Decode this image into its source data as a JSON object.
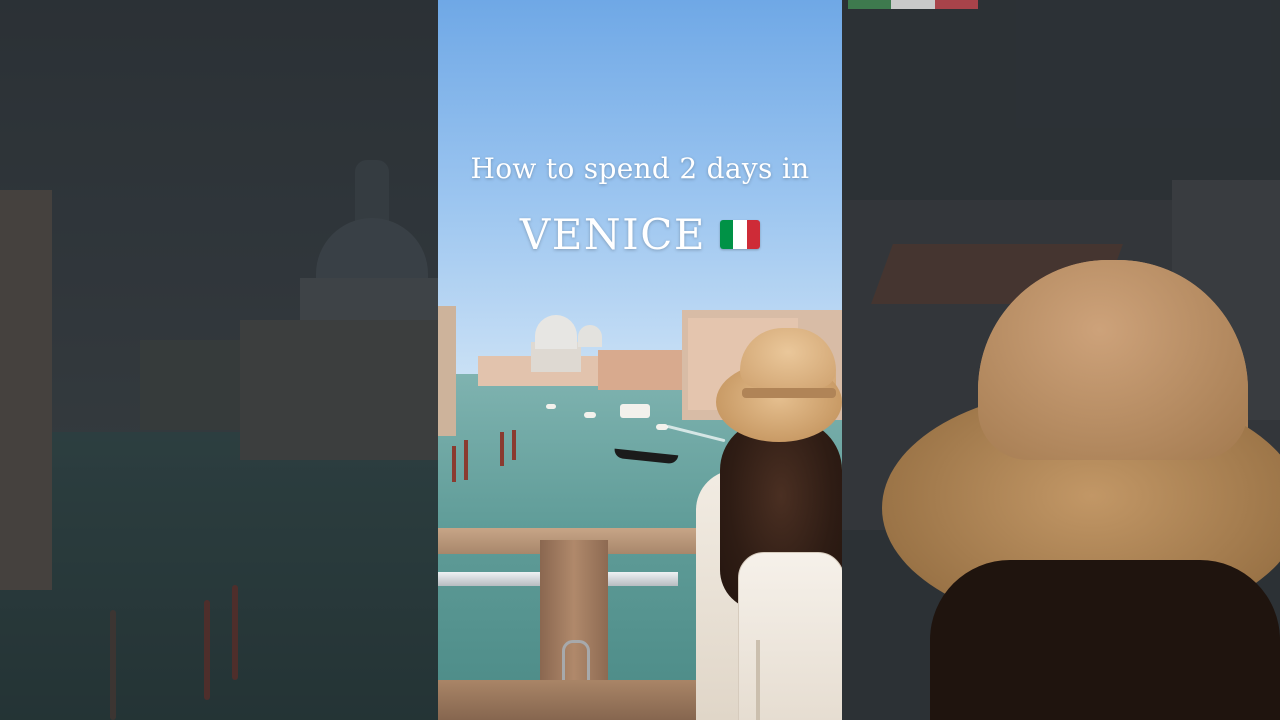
{
  "overlay": {
    "line1": "How to spend 2 days in",
    "line2": "VENICE"
  },
  "flag_icon": {
    "name": "italy-flag-icon",
    "colors": [
      "#009246",
      "#ffffff",
      "#ce2b37"
    ]
  },
  "colors": {
    "sky": "#9dc6f0",
    "canal_water": "#5f9c98",
    "hat": "#d6ab78"
  }
}
